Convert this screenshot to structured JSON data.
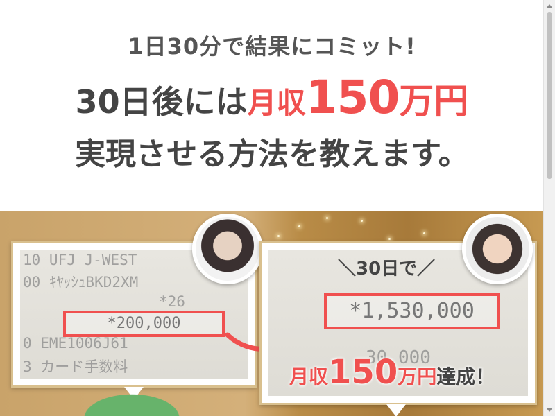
{
  "hero": {
    "tagline": "1日30分で結果にコミット!",
    "headline": {
      "prefix": "30日後には",
      "highlight_small": "月収",
      "highlight_large": "150",
      "highlight_unit": "万円"
    },
    "subline": "実現させる方法を教えます。"
  },
  "before_card": {
    "receipt_lines": [
      "10 UFJ J-WEST",
      "00 ｷﾔｯｼｭBKD2XM",
      "*26",
      "0 EME1006J61",
      "3 カード手数料"
    ],
    "amount": "*200,000"
  },
  "after_card": {
    "label": "＼30日で／",
    "receipt_lines": [
      "30,000"
    ],
    "amount": "*1,530,000",
    "achievement": {
      "prefix": "月収",
      "number": "150",
      "unit": "万円",
      "suffix": "達成！"
    }
  },
  "colors": {
    "accent_red": "#f0504f",
    "highlight_yellow": "#fbfa7d",
    "text_dark": "#444444",
    "gold": "#c9a36a"
  },
  "icons": {
    "arrow": "curved-arrow-icon"
  }
}
